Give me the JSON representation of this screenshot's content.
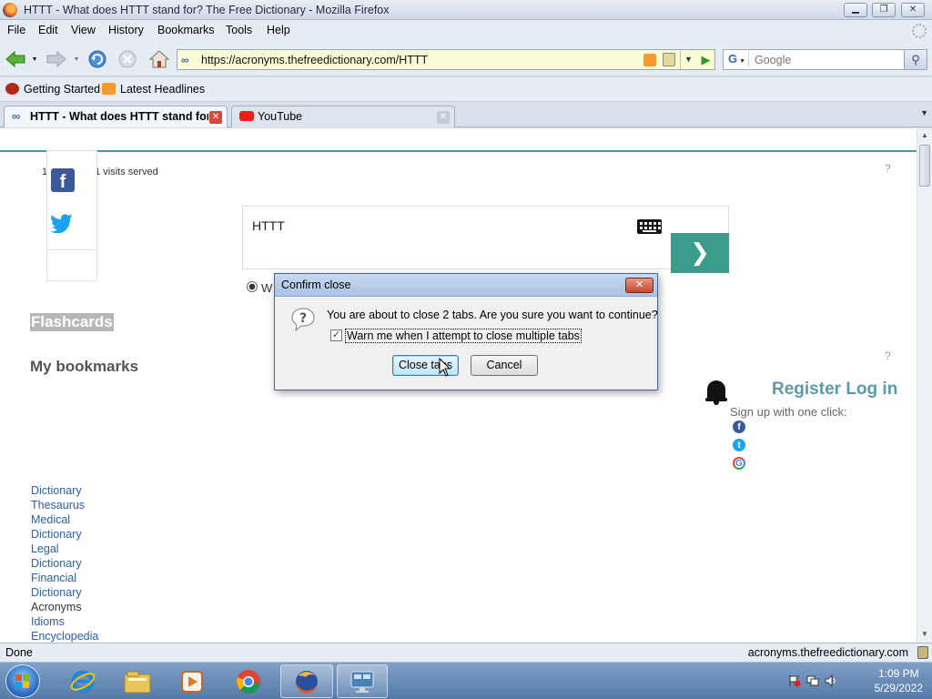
{
  "window": {
    "title": "HTTT - What does HTTT stand for? The Free Dictionary - Mozilla Firefox"
  },
  "menu": [
    "File",
    "Edit",
    "View",
    "History",
    "Bookmarks",
    "Tools",
    "Help"
  ],
  "navbar": {
    "url": "https://acronyms.thefreedictionary.com/HTTT",
    "search_placeholder": "Google"
  },
  "bookmarks": [
    "Getting Started",
    "Latest Headlines"
  ],
  "tabs": [
    {
      "label": "HTTT - What does HTTT stand for...",
      "active": true
    },
    {
      "label": "YouTube",
      "active": false
    }
  ],
  "page": {
    "visits_text": "1             381 visits served",
    "search_term": "HTTT",
    "radio_label": "W",
    "flashcards": "Flashcards",
    "my_bookmarks": "My bookmarks",
    "register": "Register",
    "login": "Log in",
    "signup_text": "Sign up with one click:",
    "help_mark": "?",
    "dict_links": [
      "Dictionary",
      "Thesaurus",
      "Medical",
      "Dictionary",
      "Legal",
      "Dictionary",
      "Financial",
      "Dictionary",
      "Acronyms",
      "Idioms",
      "Encyclopedia"
    ],
    "current_link": "Acronyms"
  },
  "dialog": {
    "title": "Confirm close",
    "message": "You are about to close 2 tabs. Are you sure you want to continue?",
    "checkbox_label": "Warn me when I attempt to close multiple tabs",
    "checkbox_checked": true,
    "primary_button": "Close tabs",
    "cancel_button": "Cancel"
  },
  "status": {
    "text": "Done",
    "host": "acronyms.thefreedictionary.com"
  },
  "taskbar": {
    "time": "1:09 PM",
    "date": "5/29/2022"
  },
  "colors": {
    "accent_teal": "#3c9c8c",
    "link_blue": "#2a62a8",
    "facebook": "#3b5998",
    "twitter": "#1da1f2"
  }
}
